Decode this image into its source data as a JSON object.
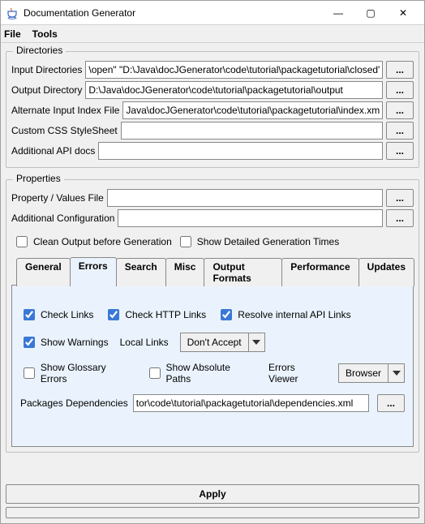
{
  "window": {
    "title": "Documentation Generator",
    "controls": {
      "min": "—",
      "max": "▢",
      "close": "✕"
    }
  },
  "menubar": {
    "file": "File",
    "tools": "Tools"
  },
  "directories": {
    "legend": "Directories",
    "input_dirs_label": "Input Directories",
    "input_dirs_value": "\\open\" \"D:\\Java\\docJGenerator\\code\\tutorial\\packagetutorial\\closed\"",
    "output_dir_label": "Output Directory",
    "output_dir_value": "D:\\Java\\docJGenerator\\code\\tutorial\\packagetutorial\\output",
    "alt_index_label": "Alternate Input Index File",
    "alt_index_value": "Java\\docJGenerator\\code\\tutorial\\packagetutorial\\index.xml",
    "css_label": "Custom CSS StyleSheet",
    "css_value": "",
    "api_label": "Additional API docs",
    "api_value": "",
    "browse": "..."
  },
  "properties": {
    "legend": "Properties",
    "propfile_label": "Property / Values File",
    "propfile_value": "",
    "addconf_label": "Additional Configuration",
    "addconf_value": "",
    "browse": "...",
    "clean_label": "Clean Output before Generation",
    "clean_checked": false,
    "times_label": "Show Detailed Generation Times",
    "times_checked": false
  },
  "tabs": {
    "general": "General",
    "errors": "Errors",
    "search": "Search",
    "misc": "Misc",
    "output": "Output Formats",
    "performance": "Performance",
    "updates": "Updates"
  },
  "errors_tab": {
    "check_links": {
      "label": "Check Links",
      "checked": true
    },
    "check_http": {
      "label": "Check HTTP Links",
      "checked": true
    },
    "resolve_api": {
      "label": "Resolve internal API Links",
      "checked": true
    },
    "show_warnings": {
      "label": "Show Warnings",
      "checked": true
    },
    "local_links_label": "Local Links",
    "local_links_value": "Don't Accept",
    "glossary": {
      "label": "Show Glossary Errors",
      "checked": false
    },
    "abspaths": {
      "label": "Show Absolute Paths",
      "checked": false
    },
    "errors_viewer_label": "Errors Viewer",
    "errors_viewer_value": "Browser",
    "packages_dep_label": "Packages Dependencies",
    "packages_dep_value": "tor\\code\\tutorial\\packagetutorial\\dependencies.xml",
    "browse": "..."
  },
  "apply": "Apply"
}
